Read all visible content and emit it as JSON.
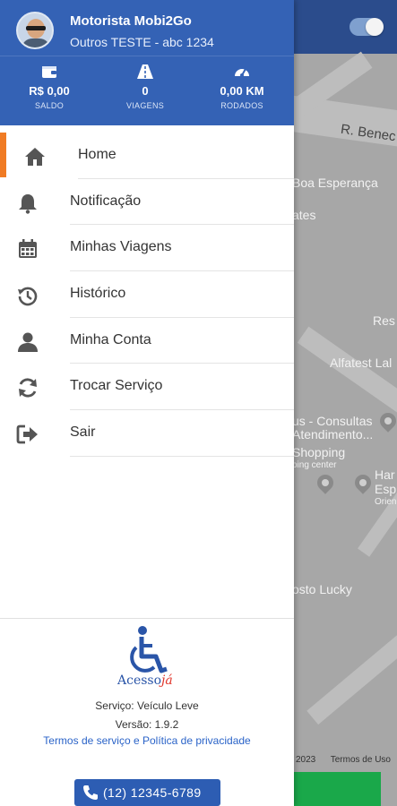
{
  "map": {
    "street_label": "R. Benec",
    "labels": [
      "Boa Esperança",
      "ates",
      "Res",
      "Alfatest Lal",
      "us - Consultas",
      "Atendimento...",
      "Shopping",
      "ping center",
      "Har",
      "Esp",
      "Orien",
      "osto Lucky"
    ],
    "footer_year": "2023",
    "footer_terms": "Termos de Uso"
  },
  "header": {
    "driver_name": "Motorista Mobi2Go",
    "vehicle": "Outros TESTE - abc 1234",
    "stats": [
      {
        "icon": "wallet-icon",
        "value": "R$ 0,00",
        "label": "SALDO"
      },
      {
        "icon": "road-icon",
        "value": "0",
        "label": "VIAGENS"
      },
      {
        "icon": "speedometer-icon",
        "value": "0,00 KM",
        "label": "RODADOS"
      }
    ]
  },
  "menu": {
    "items": [
      {
        "label": "Home",
        "icon": "home-icon",
        "active": true
      },
      {
        "label": "Notificação",
        "icon": "bell-icon"
      },
      {
        "label": "Minhas Viagens",
        "icon": "calendar-icon"
      },
      {
        "label": "Histórico",
        "icon": "history-icon"
      },
      {
        "label": "Minha Conta",
        "icon": "user-icon"
      },
      {
        "label": "Trocar Serviço",
        "icon": "sync-icon"
      },
      {
        "label": "Sair",
        "icon": "sign-out-icon"
      }
    ]
  },
  "footer": {
    "logo_text_main": "Acesso",
    "logo_text_accent": "já",
    "service": "Serviço: Veículo Leve",
    "version": "Versão: 1.9.2",
    "terms_link": "Termos de serviço e Política de privacidade",
    "phone": "(12) 12345-6789"
  },
  "colors": {
    "header_bg": "#3462b5",
    "accent_orange": "#f07b24",
    "phone_button": "#2d5db3",
    "map_green_button": "#1aa84a"
  }
}
